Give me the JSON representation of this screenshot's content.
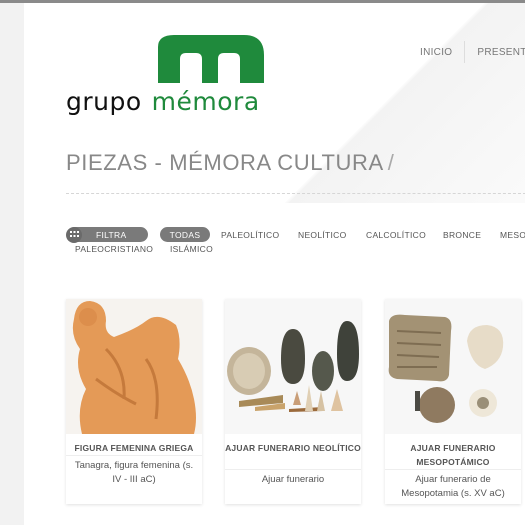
{
  "logo": {
    "word1": "grupo",
    "word2": "mémora",
    "green": "#1f8a3c"
  },
  "nav": [
    {
      "label": "INICIO"
    },
    {
      "label": "PRESENTA"
    }
  ],
  "page_title": "PIEZAS - MÉMORA CULTURA",
  "title_separator": "/",
  "filters": {
    "filtra_label": "FILTRA",
    "todas_label": "TODAS",
    "items": [
      "PALEOLÍTICO",
      "NEOLÍTICO",
      "CALCOLÍTICO",
      "BRONCE",
      "MESO",
      "PALEOCRISTIANO",
      "ISLÁMICO"
    ]
  },
  "cards": [
    {
      "name": "FIGURA FEMENINA GRIEGA",
      "description": "Tanagra, figura femenina (s. IV - III aC)"
    },
    {
      "name": "AJUAR FUNERARIO NEOLÍTICO",
      "description": "Ajuar funerario"
    },
    {
      "name": "AJUAR FUNERARIO MESOPOTÁMICO",
      "description": "Ajuar funerario de Mesopotamia (s. XV aC)"
    }
  ],
  "colors": {
    "brand_green": "#1f8a3c",
    "pill_gray": "#7a7a7a",
    "title_gray": "#888888"
  }
}
